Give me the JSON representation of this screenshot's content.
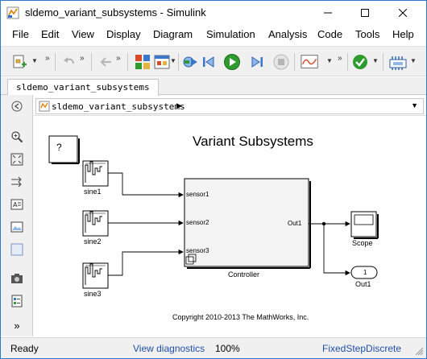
{
  "window": {
    "title": "sldemo_variant_subsystems - Simulink"
  },
  "menu": [
    {
      "label": "File"
    },
    {
      "label": "Edit"
    },
    {
      "label": "View"
    },
    {
      "label": "Display"
    },
    {
      "label": "Diagram"
    },
    {
      "label": "Simulation"
    },
    {
      "label": "Analysis"
    },
    {
      "label": "Code"
    },
    {
      "label": "Tools"
    },
    {
      "label": "Help"
    }
  ],
  "toolbar": {
    "icons": [
      "new-model-icon",
      "undo-icon",
      "back-icon",
      "library-browser-icon",
      "model-config-icon",
      "step-back-icon",
      "run-icon",
      "step-forward-icon",
      "stop-icon",
      "record-icon",
      "model-advisor-icon",
      "build-icon"
    ]
  },
  "tab": {
    "label": "sldemo_variant_subsystems"
  },
  "address": {
    "path": "sldemo_variant_subsystems"
  },
  "diagram": {
    "title": "Variant Subsystems",
    "copyright": "Copyright 2010-2013 The MathWorks, Inc.",
    "help_block": "?",
    "blocks": {
      "sine1": "sine1",
      "sine2": "sine2",
      "sine3": "sine3",
      "controller": "Controller",
      "scope": "Scope",
      "out1": "Out1",
      "out1_port_number": "1"
    },
    "ports": {
      "in1": "sensor1",
      "in2": "sensor2",
      "in3": "sensor3",
      "out": "Out1"
    }
  },
  "status": {
    "state": "Ready",
    "diagnostics_link": "View diagnostics",
    "zoom": "100%",
    "solver": "FixedStepDiscrete"
  },
  "colors": {
    "accent_blue": "#1f4fa8",
    "window_border": "#2b79c8",
    "run_green": "#2e9b2e",
    "block_fill": "#f3f3f3"
  }
}
